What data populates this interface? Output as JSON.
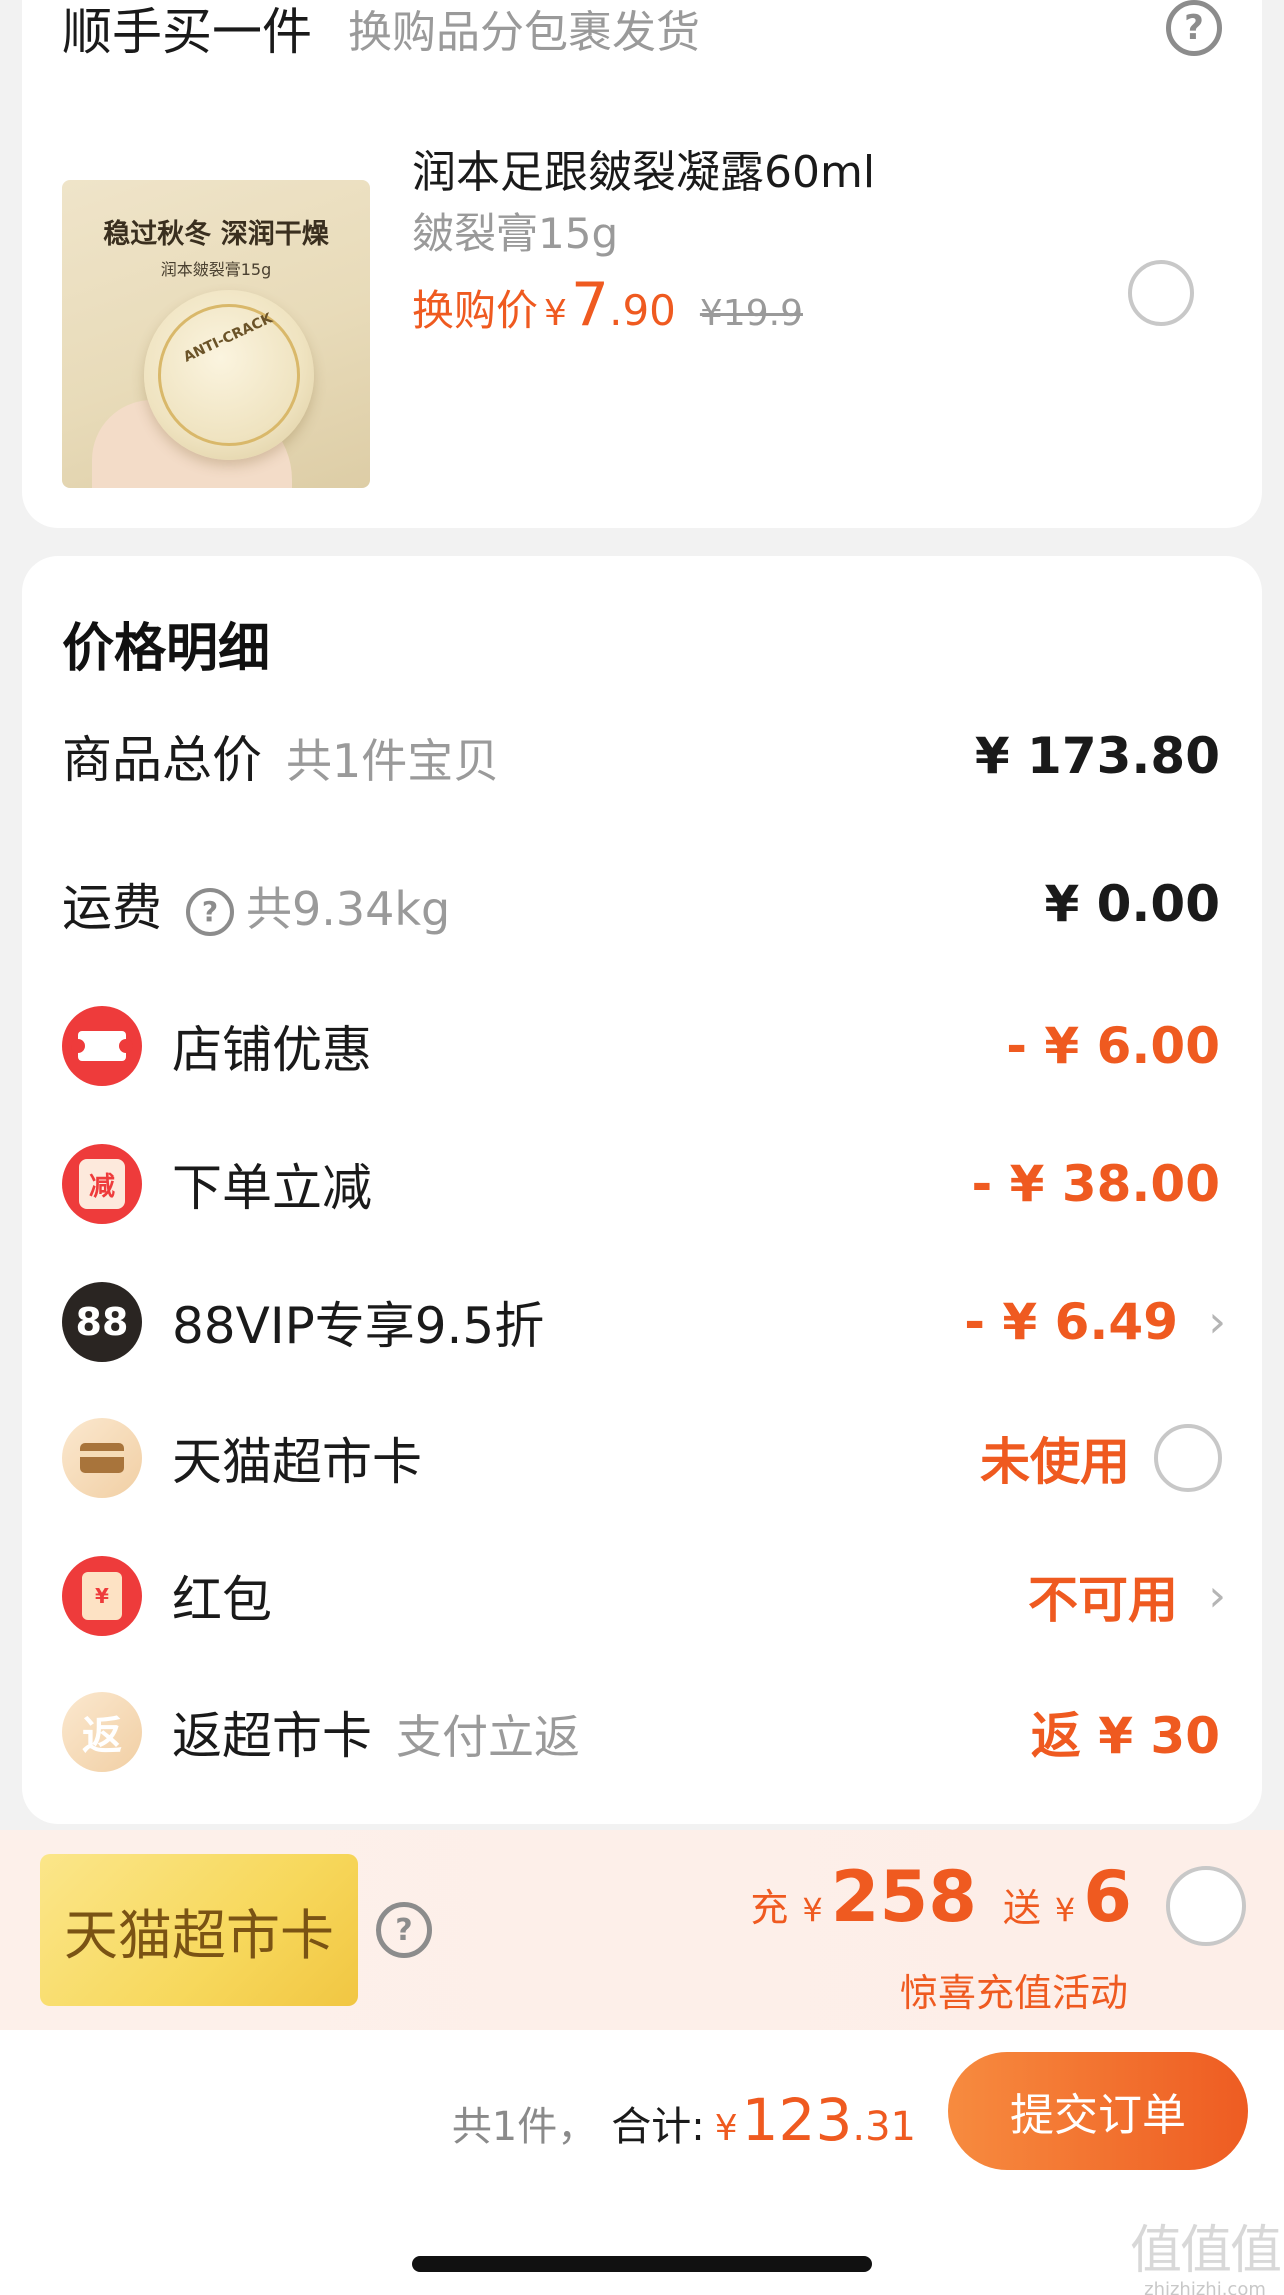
{
  "addon": {
    "title": "顺手买一件",
    "subtitle": "换购品分包裹发货",
    "help_icon": "question-circle-icon",
    "product": {
      "name": "润本足跟皴裂凝露60ml",
      "sku": "皴裂膏15g",
      "price_label": "换购价",
      "currency": "¥",
      "price_int": "7",
      "price_dec": ".90",
      "original_price": "¥19.9",
      "thumb_text_1": "稳过秋冬 深润干燥",
      "thumb_text_2": "润本皴裂膏15g",
      "thumb_jar_label": "ANTI-CRACK"
    },
    "selected": false
  },
  "price_detail": {
    "title": "价格明细",
    "rows": [
      {
        "label": "商品总价",
        "sub": "共1件宝贝",
        "amount": "¥ 173.80"
      },
      {
        "label": "运费",
        "sub": "共9.34kg",
        "amount": "¥ 0.00"
      },
      {
        "label": "店铺优惠",
        "amount": "- ¥ 6.00",
        "icon": "coupon-ticket-icon"
      },
      {
        "label": "下单立减",
        "amount": "- ¥ 38.00",
        "icon": "discount-jian-icon",
        "icon_text": "减"
      },
      {
        "label": "88VIP专享9.5折",
        "amount": "- ¥ 6.49",
        "icon": "vip-88-icon",
        "icon_text": "88"
      },
      {
        "label": "天猫超市卡",
        "amount": "未使用",
        "icon": "supermarket-card-icon"
      },
      {
        "label": "红包",
        "amount": "不可用",
        "icon": "red-envelope-icon",
        "icon_text": "¥"
      },
      {
        "label": "返超市卡",
        "sub": "支付立返",
        "amount": "返 ¥ 30",
        "icon": "rebate-fan-icon",
        "icon_text": "返"
      }
    ]
  },
  "promo": {
    "card_label": "天猫超市卡",
    "charge_label": "充",
    "currency": "¥",
    "charge_amount": "258",
    "gift_label": "送",
    "gift_amount": "6",
    "activity_text": "惊喜充值活动",
    "selected": false
  },
  "checkout": {
    "count_text": "共1件，",
    "total_label": "合计:",
    "currency": "¥",
    "total_int": "123",
    "total_dec": ".31",
    "submit_label": "提交订单"
  },
  "watermark": {
    "glyphs": "值值值",
    "url": "zhizhizhi.com"
  },
  "colors": {
    "accent": "#ef5a20",
    "red_icon": "#ee3b3b",
    "muted_text": "#9a9a9a",
    "background": "#f2f2f2"
  }
}
